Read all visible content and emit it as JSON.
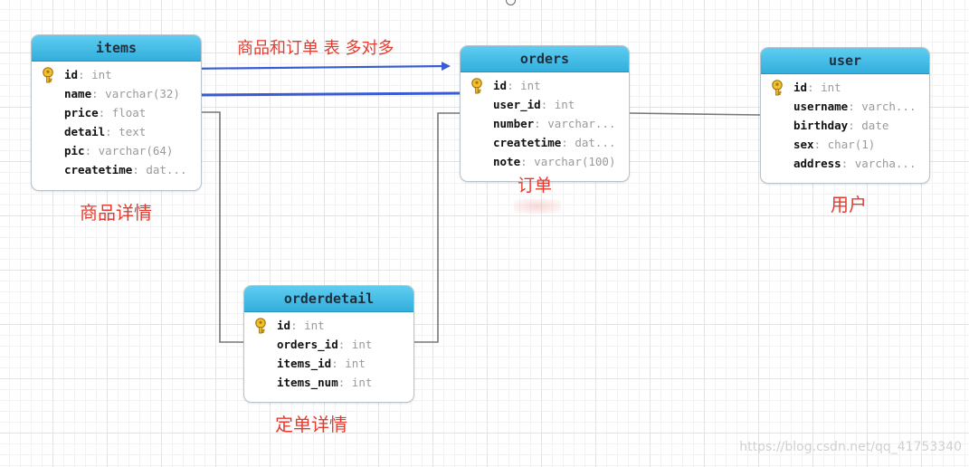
{
  "tables": {
    "items": {
      "name": "items",
      "fields": [
        {
          "name": "id",
          "type": "int",
          "pk": true
        },
        {
          "name": "name",
          "type": "varchar(32)"
        },
        {
          "name": "price",
          "type": "float"
        },
        {
          "name": "detail",
          "type": "text"
        },
        {
          "name": "pic",
          "type": "varchar(64)"
        },
        {
          "name": "createtime",
          "type": "dat..."
        }
      ]
    },
    "orders": {
      "name": "orders",
      "fields": [
        {
          "name": "id",
          "type": "int",
          "pk": true
        },
        {
          "name": "user_id",
          "type": "int"
        },
        {
          "name": "number",
          "type": "varchar..."
        },
        {
          "name": "createtime",
          "type": "dat..."
        },
        {
          "name": "note",
          "type": "varchar(100)"
        }
      ]
    },
    "user": {
      "name": "user",
      "fields": [
        {
          "name": "id",
          "type": "int",
          "pk": true
        },
        {
          "name": "username",
          "type": "varch..."
        },
        {
          "name": "birthday",
          "type": "date"
        },
        {
          "name": "sex",
          "type": "char(1)"
        },
        {
          "name": "address",
          "type": "varcha..."
        }
      ]
    },
    "orderdetail": {
      "name": "orderdetail",
      "fields": [
        {
          "name": "id",
          "type": "int",
          "pk": true
        },
        {
          "name": "orders_id",
          "type": "int"
        },
        {
          "name": "items_id",
          "type": "int"
        },
        {
          "name": "items_num",
          "type": "int"
        }
      ]
    }
  },
  "labels": {
    "items": "商品详情",
    "orders": "订单",
    "user": "用户",
    "orderdetail": "定单详情",
    "relation": "商品和订单 表 多对多"
  },
  "watermark": "https://blog.csdn.net/qq_41753340",
  "colors": {
    "header": "#3cb8e6",
    "annotation": "#e63a2e",
    "arrow": "#3a5bd4",
    "connector": "#777777"
  },
  "icons": {
    "primary_key": "key-icon"
  }
}
